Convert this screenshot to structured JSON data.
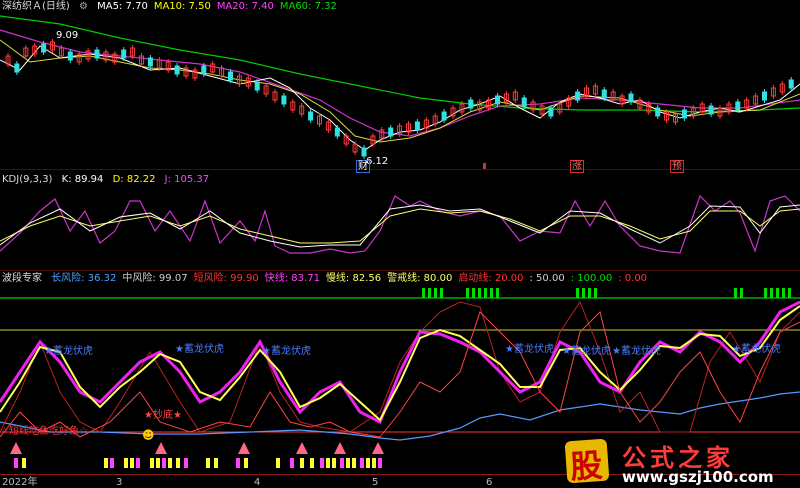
{
  "price_panel": {
    "title": "深纺织Ａ(日线)",
    "ma": [
      {
        "label": "MA5:",
        "value": "7.70",
        "color": "#ffffff"
      },
      {
        "label": "MA10:",
        "value": "7.50",
        "color": "#ffff00"
      },
      {
        "label": "MA20:",
        "value": "7.40",
        "color": "#ff44ff"
      },
      {
        "label": "MA60:",
        "value": "7.32",
        "color": "#00dd00"
      }
    ],
    "high_label": "9.09",
    "low_label": "6.12",
    "markers": [
      "财",
      "涨",
      "预"
    ]
  },
  "kdj_panel": {
    "title": "KDJ(9,3,3)",
    "k": "K: 89.94",
    "d": "D: 82.22",
    "j": "J: 105.37"
  },
  "wave_panel": {
    "title": "波段专家",
    "items": [
      {
        "text": "长风险: 36.32",
        "color": "#4aa0ff"
      },
      {
        "text": "中风险: 99.07",
        "color": "#cccccc"
      },
      {
        "text": "短风险: 99.90",
        "color": "#ff3333"
      },
      {
        "text": "快线: 83.71",
        "color": "#ff44ff"
      },
      {
        "text": "慢线: 82.56",
        "color": "#ffff66"
      },
      {
        "text": "警戒线: 80.00",
        "color": "#ffff66"
      },
      {
        "text": "启动线: 20.00",
        "color": "#ff3333"
      },
      {
        "text": ": 50.00",
        "color": "#cccccc"
      },
      {
        "text": ": 100.00",
        "color": "#00dd00"
      },
      {
        "text": ": 0.00",
        "color": "#ff3333"
      }
    ],
    "labels_blue": [
      "★蓄龙伏虎",
      "★蓄龙伏虎",
      "★蓄龙伏虎",
      "★蓄龙伏虎",
      "★蓄龙伏虎",
      "★蓄龙伏虎",
      "★蓄龙伏虎"
    ],
    "red_text": "★抄底★",
    "red_band": "☆短线吃鱼吃好鱼☆"
  },
  "x_axis": [
    "2022年",
    "3",
    "4",
    "5",
    "6"
  ],
  "watermark": {
    "big": "股",
    "name": "公式之家",
    "url": "www.gszj100.com"
  }
}
